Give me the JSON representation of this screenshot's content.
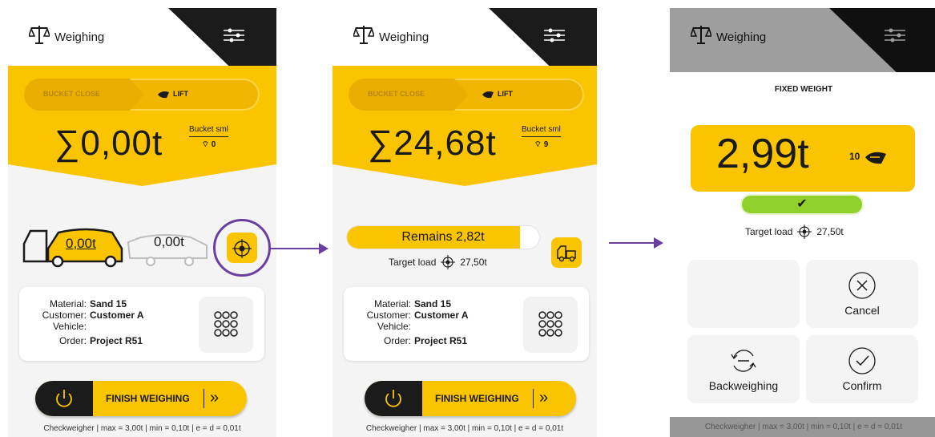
{
  "colors": {
    "accent": "#fbc400",
    "dark": "#1b1b1b",
    "highlight": "#6b3fa0",
    "ok": "#8fd12a"
  },
  "screens": [
    {
      "header": {
        "title": "Weighing"
      },
      "mode": {
        "left": "BUCKET CLOSE",
        "right": "LIFT"
      },
      "total": "∑0,00t",
      "bucket": {
        "label": "Bucket sml",
        "count": "0"
      },
      "truck": {
        "value": "0,00t",
        "trailer_value": "0,00t"
      },
      "info": {
        "material_label": "Material:",
        "material": "Sand 15",
        "customer_label": "Customer:",
        "customer": "Customer A",
        "vehicle_label": "Vehicle:",
        "vehicle": "",
        "order_label": "Order:",
        "order": "Project R51"
      },
      "finish": "FINISH WEIGHING",
      "footer": "Checkweigher | max = 3,00t | min = 0,10t | e = d = 0,01t"
    },
    {
      "header": {
        "title": "Weighing"
      },
      "mode": {
        "left": "BUCKET CLOSE",
        "right": "LIFT"
      },
      "total": "∑24,68t",
      "bucket": {
        "label": "Bucket sml",
        "count": "9"
      },
      "remains": {
        "text": "Remains 2,82t",
        "fill_fraction": 0.9
      },
      "target": {
        "label": "Target load",
        "value": "27,50t"
      },
      "info": {
        "material_label": "Material:",
        "material": "Sand 15",
        "customer_label": "Customer:",
        "customer": "Customer A",
        "vehicle_label": "Vehicle:",
        "vehicle": "",
        "order_label": "Order:",
        "order": "Project R51"
      },
      "finish": "FINISH WEIGHING",
      "footer": "Checkweigher | max = 3,00t | min = 0,10t | e = d = 0,01t"
    },
    {
      "header": {
        "title": "Weighing"
      },
      "modal": {
        "title": "FIXED WEIGHT",
        "weight": "2,99t",
        "count": "10",
        "status": "✔",
        "target_label": "Target load",
        "target_value": "27,50t",
        "cancel": "Cancel",
        "backweighing": "Backweighing",
        "confirm": "Confirm"
      },
      "footer": "Checkweigher | max = 3,00t | min = 0,10t | e = d = 0,01t"
    }
  ]
}
